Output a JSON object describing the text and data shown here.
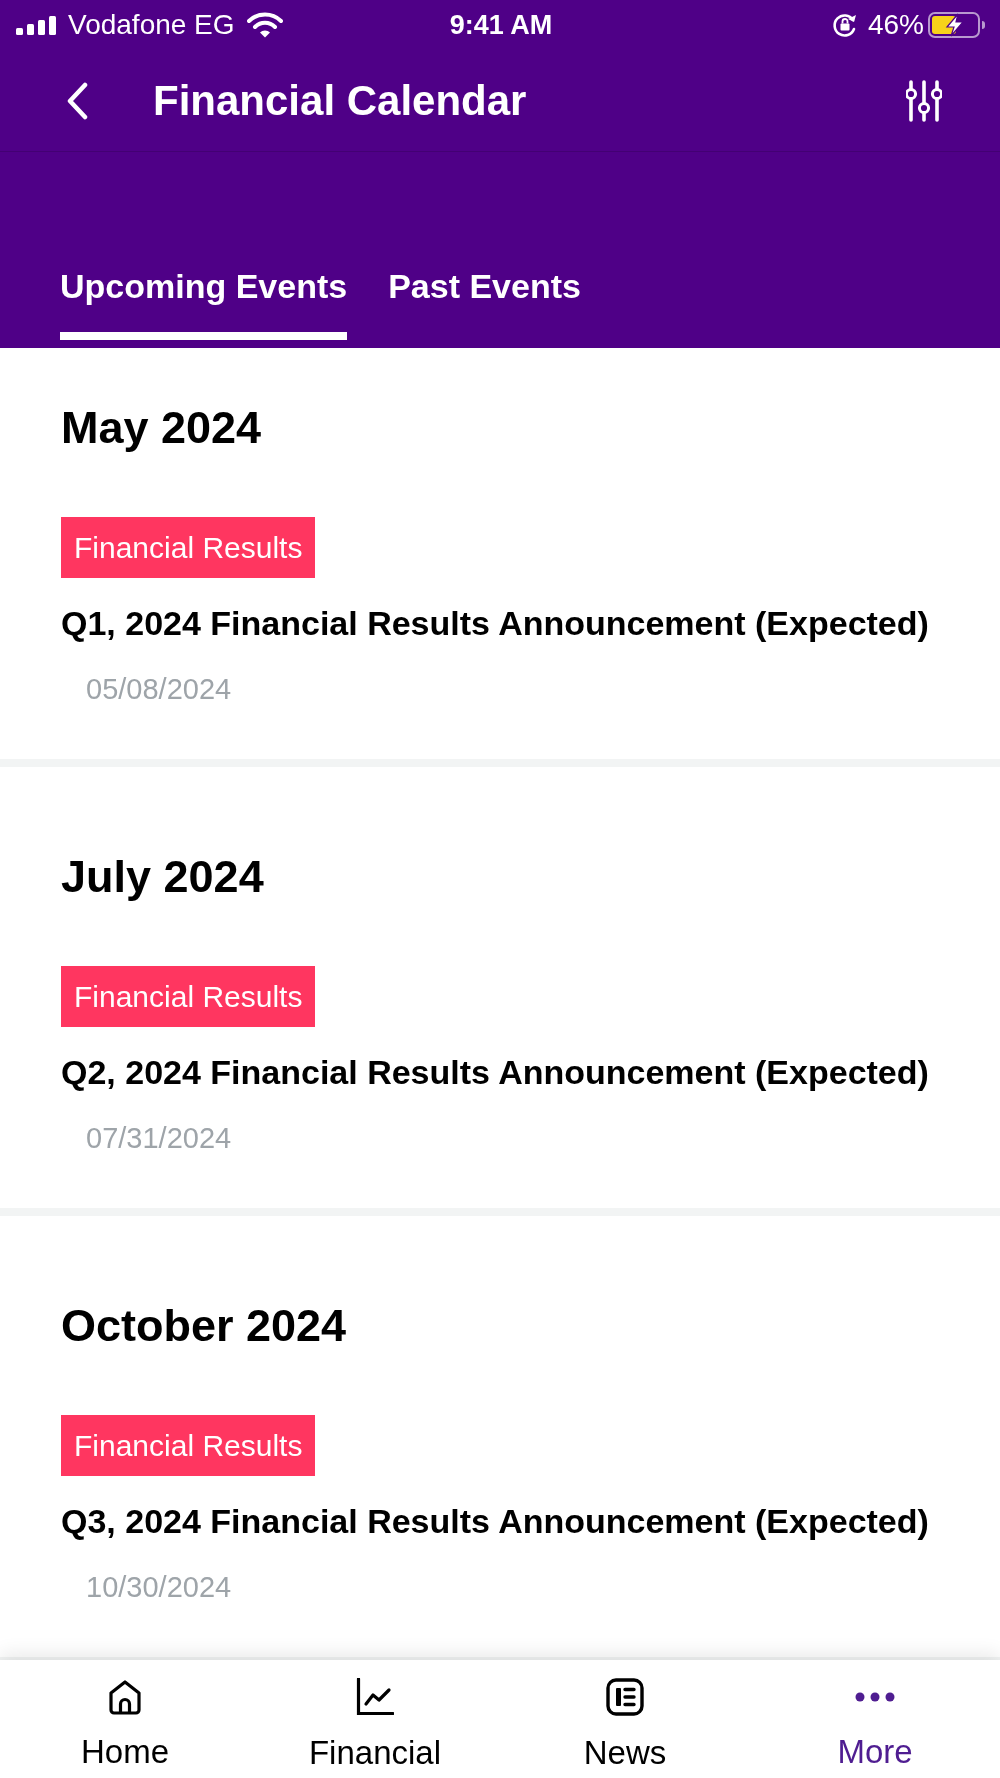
{
  "status_bar": {
    "carrier": "Vodafone EG",
    "time": "9:41 AM",
    "battery": "46%"
  },
  "header": {
    "title": "Financial Calendar"
  },
  "tabs": [
    {
      "label": "Upcoming Events",
      "selected": true
    },
    {
      "label": "Past Events",
      "selected": false
    }
  ],
  "sections": [
    {
      "month": "May 2024",
      "events": [
        {
          "tag": "Financial Results",
          "title": "Q1, 2024 Financial Results Announcement (Expected)",
          "date": "05/08/2024"
        }
      ]
    },
    {
      "month": "July 2024",
      "events": [
        {
          "tag": "Financial Results",
          "title": "Q2, 2024 Financial Results Announcement (Expected)",
          "date": "07/31/2024"
        }
      ]
    },
    {
      "month": "October 2024",
      "events": [
        {
          "tag": "Financial Results",
          "title": "Q3, 2024 Financial Results Announcement (Expected)",
          "date": "10/30/2024"
        }
      ]
    }
  ],
  "bottom_nav": [
    {
      "label": "Home",
      "selected": false
    },
    {
      "label": "Financial",
      "selected": false
    },
    {
      "label": "News",
      "selected": false
    },
    {
      "label": "More",
      "selected": true
    }
  ]
}
